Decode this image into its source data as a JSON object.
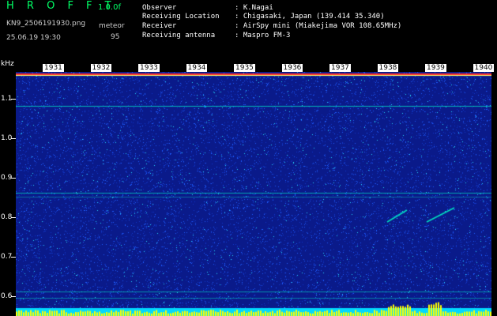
{
  "header": {
    "app_name": "H R O F F T",
    "version": "1.0.0f",
    "filename": "KN9_2506191930.png",
    "datetime": "25.06.19 19:30",
    "meteor_label": "meteor",
    "meteor_count": "95"
  },
  "info": {
    "observer_label": "Observer",
    "observer_value": ": K.Nagai",
    "location_label": "Receiving Location",
    "location_value": ": Chigasaki, Japan (139.414 35.340)",
    "receiver_label": "Receiver",
    "receiver_value": ": AirSpy mini (Miakejima VOR 108.65MHz)",
    "antenna_label": "Receiving antenna",
    "antenna_value": ": Maspro FM-3"
  },
  "axis": {
    "unit": "kHz",
    "labels": [
      "1.1",
      "1.0",
      "0.9",
      "0.8",
      "0.7",
      "0.6"
    ]
  },
  "time_labels": [
    "1931",
    "1932",
    "1933",
    "1934",
    "1935",
    "1936",
    "1937",
    "1938",
    "1939",
    "1940"
  ],
  "colors": {
    "background": "#000000",
    "spectrum_base": "#0a1a8a",
    "noise": "#1e5cff",
    "noise_bright": "#28d9ff",
    "trace": "#00e0c0",
    "top_line": "#ff3030",
    "bottom_band": "#00d8ff",
    "peaks": "#ffff00"
  }
}
